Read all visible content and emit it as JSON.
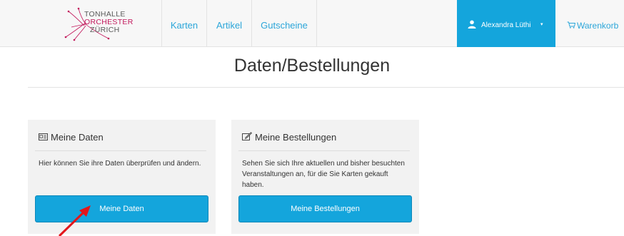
{
  "header": {
    "logo": {
      "line1": "TONHALLE",
      "line2": "ORCHESTER",
      "line3": "ZÜRICH"
    },
    "nav": [
      {
        "label": "Karten"
      },
      {
        "label": "Artikel"
      },
      {
        "label": "Gutscheine"
      }
    ],
    "user": {
      "name": "Alexandra Lüthi",
      "icon": "user-icon",
      "caret": "▾"
    },
    "cart": {
      "label": "Warenkorb",
      "icon": "cart-icon"
    }
  },
  "page": {
    "title": "Daten/Bestellungen"
  },
  "cards": [
    {
      "icon": "id-card-icon",
      "title": "Meine Daten",
      "text": "Hier können Sie ihre Daten überprüfen und ändern.",
      "button": "Meine Daten"
    },
    {
      "icon": "edit-icon",
      "title": "Meine Bestellungen",
      "text": "Sehen Sie sich Ihre aktuellen und bisher besuchten Veranstaltungen an, für die Sie Karten gekauft haben.",
      "button": "Meine Bestellungen"
    }
  ],
  "colors": {
    "accent": "#14a5dc",
    "link": "#2ba6d9",
    "logo_magenta": "#c2185b",
    "annotation_arrow": "#e3161b"
  }
}
